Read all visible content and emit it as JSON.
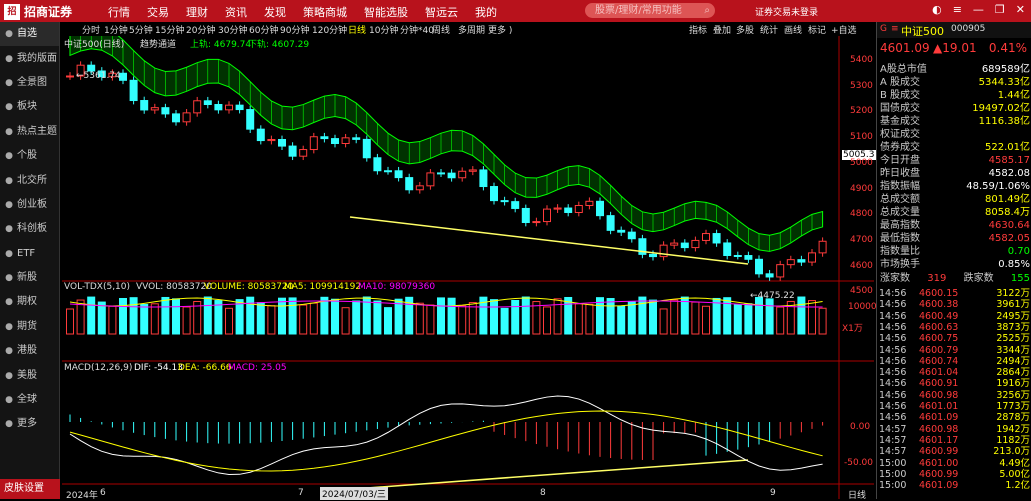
{
  "topbar": {
    "logo_mark": "招商",
    "logo_text": "招商证券",
    "menu": [
      "行情",
      "交易",
      "理财",
      "资讯",
      "发现",
      "策略商城",
      "智能选股",
      "智远云",
      "我的"
    ],
    "search_placeholder": "股票/理财/常用功能",
    "account": "证券交易未登录"
  },
  "sidebar": {
    "items": [
      {
        "label": "自选",
        "icon": "heart-icon"
      },
      {
        "label": "我的版面",
        "icon": "layout-icon"
      },
      {
        "label": "全景图",
        "icon": "panorama-icon"
      },
      {
        "label": "板块",
        "icon": "block-icon"
      },
      {
        "label": "热点主题",
        "icon": "fire-icon"
      },
      {
        "label": "个股",
        "icon": "person-icon"
      },
      {
        "label": "北交所",
        "icon": "building-icon"
      },
      {
        "label": "创业板",
        "icon": "rocket-icon"
      },
      {
        "label": "科创板",
        "icon": "chip-icon"
      },
      {
        "label": "ETF",
        "icon": "etf-icon"
      },
      {
        "label": "新股",
        "icon": "star-icon"
      },
      {
        "label": "期权",
        "icon": "option-icon"
      },
      {
        "label": "期货",
        "icon": "futures-icon"
      },
      {
        "label": "港股",
        "icon": "hk-icon"
      },
      {
        "label": "美股",
        "icon": "us-icon"
      },
      {
        "label": "全球",
        "icon": "globe-icon"
      },
      {
        "label": "更多",
        "icon": "more-icon"
      }
    ],
    "bottom": "皮肤设置"
  },
  "toolbar": {
    "periods": [
      "分时",
      "1分钟",
      "5分钟",
      "15分钟",
      "20分钟",
      "30分钟",
      "60分钟",
      "90分钟",
      "120分钟",
      "日线",
      "10分钟",
      "分钟*40",
      "周线",
      "多周期",
      "更多 )"
    ],
    "active_period": "日线",
    "right": [
      "指标",
      "叠加",
      "多股",
      "统计",
      "画线",
      "标记",
      "+自选"
    ]
  },
  "chart": {
    "title": "中证500(日线)",
    "indicator_name": "趋势通道",
    "upper_label": "上轨: 4679.74",
    "lower_label": "下轨: 4607.29",
    "high_mark": "5361.74",
    "low_mark": "4475.22",
    "current_price_tag": "5005.3",
    "price_axis": [
      "5400",
      "5300",
      "5200",
      "5100",
      "5000",
      "4900",
      "4800",
      "4700",
      "4600",
      "4500"
    ],
    "vol_label": "VOL-TDX(5,10)",
    "vvol": "VVOL: 80583720",
    "volume": "VOLUME: 80583720",
    "ma5": "MA5: 109914192",
    "ma10": "MA10: 98079360",
    "vol_axis": "10000",
    "vol_unit": "X1万",
    "macd_label": "MACD(12,26,9)",
    "dif": "DIF: -54.13",
    "dea": "DEA: -66.66",
    "macd": "MACD: 25.05",
    "macd_axis": [
      "0.00",
      "-50.00"
    ],
    "date_axis": [
      "2024年",
      "6",
      "7",
      "8",
      "9"
    ],
    "cursor_date": "2024/07/03/三",
    "period_btn": "日线",
    "colors": {
      "up": "#ff3b3b",
      "down": "#3ff",
      "channel": "#0f0"
    }
  },
  "quote": {
    "name": "中证500",
    "code": "000905",
    "price": "4601.09",
    "change": "▲19.01",
    "pct": "0.41%",
    "rows": [
      [
        "A股总市值",
        "689589亿",
        "white"
      ],
      [
        "A 股成交",
        "5344.33亿",
        "yellow"
      ],
      [
        "B 股成交",
        "1.44亿",
        "yellow"
      ],
      [
        "国债成交",
        "19497.02亿",
        "yellow"
      ],
      [
        "基金成交",
        "1116.38亿",
        "yellow"
      ],
      [
        "权证成交",
        "",
        ""
      ],
      [
        "债券成交",
        "522.01亿",
        "yellow"
      ],
      [
        "今日开盘",
        "4585.17",
        "red"
      ],
      [
        "昨日收盘",
        "4582.08",
        "white"
      ],
      [
        "指数振幅",
        "48.59/1.06%",
        "white"
      ],
      [
        "总成交额",
        "801.49亿",
        "yellow"
      ],
      [
        "总成交量",
        "8058.4万",
        "yellow"
      ],
      [
        "最高指数",
        "4630.64",
        "red"
      ],
      [
        "最低指数",
        "4582.05",
        "red"
      ],
      [
        "指数量比",
        "0.70",
        "green"
      ],
      [
        "市场换手",
        "0.85%",
        "white"
      ]
    ],
    "up_label": "涨家数",
    "up_count": "319",
    "down_label": "跌家数",
    "down_count": "155",
    "ticks": [
      [
        "14:56",
        "4600.15",
        "3122万"
      ],
      [
        "14:56",
        "4600.38",
        "3961万"
      ],
      [
        "14:56",
        "4600.49",
        "2495万"
      ],
      [
        "14:56",
        "4600.63",
        "3873万"
      ],
      [
        "14:56",
        "4600.75",
        "2525万"
      ],
      [
        "14:56",
        "4600.79",
        "3344万"
      ],
      [
        "14:56",
        "4600.74",
        "2494万"
      ],
      [
        "14:56",
        "4601.04",
        "2864万"
      ],
      [
        "14:56",
        "4600.91",
        "1916万"
      ],
      [
        "14:56",
        "4600.98",
        "3256万"
      ],
      [
        "14:56",
        "4601.01",
        "1773万"
      ],
      [
        "14:56",
        "4601.09",
        "2878万"
      ],
      [
        "14:57",
        "4600.98",
        "1942万"
      ],
      [
        "14:57",
        "4601.17",
        "1182万"
      ],
      [
        "14:57",
        "4600.99",
        "213.0万"
      ],
      [
        "15:00",
        "4601.00",
        "4.49亿"
      ],
      [
        "15:00",
        "4600.99",
        "5.00亿"
      ],
      [
        "15:00",
        "4601.09",
        "1.2亿"
      ]
    ]
  }
}
